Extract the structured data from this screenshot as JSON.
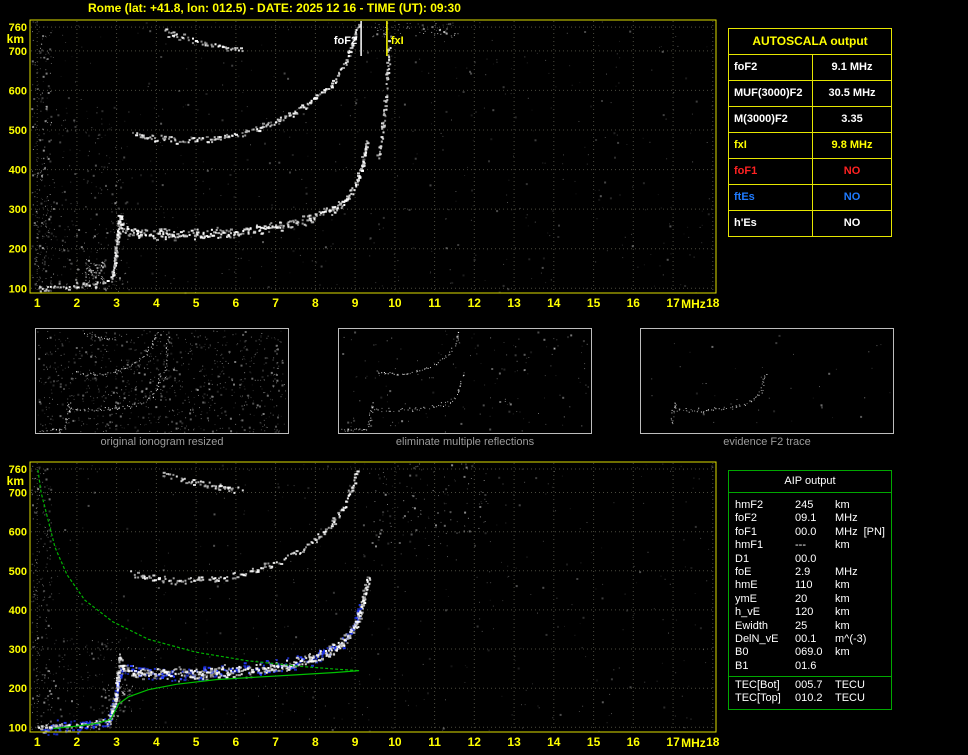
{
  "title": "Rome (lat: +41.8, lon: 012.5) - DATE: 2025 12 16 - TIME (UT): 09:30",
  "colors": {
    "accent_yellow": "#ffff00",
    "accent_green": "#00a800",
    "trace_white": "#ffffff",
    "trace_blue": "#2238ff",
    "profile_green": "#00c000",
    "alert_red": "#ff2222",
    "info_blue": "#1f7bff",
    "grid": "#4a4a3e"
  },
  "autoscala_table": {
    "header": "AUTOSCALA output",
    "rows": [
      {
        "label": "foF2",
        "value": "9.1 MHz",
        "color": "#ffffff"
      },
      {
        "label": "MUF(3000)F2",
        "value": "30.5 MHz",
        "color": "#ffffff"
      },
      {
        "label": "M(3000)F2",
        "value": "3.35",
        "color": "#ffffff"
      },
      {
        "label": "fxI",
        "value": "9.8 MHz",
        "color": "#ffff00"
      },
      {
        "label": "foF1",
        "value": "NO",
        "color": "#ff2222"
      },
      {
        "label": "ftEs",
        "value": "NO",
        "color": "#1f7bff"
      },
      {
        "label": "h'Es",
        "value": "NO",
        "color": "#ffffff"
      }
    ]
  },
  "aip_table": {
    "header": "AIP output",
    "rows": [
      {
        "label": "hmF2",
        "value": "245",
        "unit": "km",
        "note": ""
      },
      {
        "label": "foF2",
        "value": "09.1",
        "unit": "MHz",
        "note": ""
      },
      {
        "label": "foF1",
        "value": "00.0",
        "unit": "MHz",
        "note": "[PN]"
      },
      {
        "label": "hmF1",
        "value": "---",
        "unit": "km",
        "note": ""
      },
      {
        "label": "D1",
        "value": "00.0",
        "unit": "",
        "note": ""
      },
      {
        "label": "foE",
        "value": "2.9",
        "unit": "MHz",
        "note": ""
      },
      {
        "label": "hmE",
        "value": "110",
        "unit": "km",
        "note": ""
      },
      {
        "label": "ymE",
        "value": "20",
        "unit": "km",
        "note": ""
      },
      {
        "label": "h_vE",
        "value": "120",
        "unit": "km",
        "note": ""
      },
      {
        "label": "Ewidth",
        "value": "25",
        "unit": "km",
        "note": ""
      },
      {
        "label": "DelN_vE",
        "value": "00.1",
        "unit": "m^(-3)",
        "note": ""
      },
      {
        "label": "B0",
        "value": "069.0",
        "unit": "km",
        "note": ""
      },
      {
        "label": "B1",
        "value": "01.6",
        "unit": "",
        "note": ""
      }
    ],
    "tec_rows": [
      {
        "label": "TEC[Bot]",
        "value": "005.7",
        "unit": "TECU"
      },
      {
        "label": "TEC[Top]",
        "value": "010.2",
        "unit": "TECU"
      }
    ]
  },
  "thumbnails": [
    {
      "caption": "original ionogram resized",
      "series": [
        "E-trace",
        "cusp",
        "F-trace",
        "second-hop",
        "third-hop",
        "x-trace"
      ],
      "noise_count": 900
    },
    {
      "caption": "eliminate multiple reflections",
      "series": [
        "E-trace",
        "cusp",
        "F-trace",
        "second-hop"
      ],
      "noise_count": 160
    },
    {
      "caption": "evidence F2 trace",
      "series": [
        "cusp",
        "F-trace"
      ],
      "noise_count": 40
    }
  ],
  "chart_data": [
    {
      "id": "ionogram_autoscaled",
      "type": "scatter",
      "title": "",
      "xlabel": "MHz",
      "ylabel": "km",
      "xlim": [
        0.82,
        18.08
      ],
      "ylim": [
        88,
        778
      ],
      "xticks": [
        1,
        2,
        3,
        4,
        5,
        6,
        7,
        8,
        9,
        10,
        11,
        12,
        13,
        14,
        15,
        16,
        17,
        18
      ],
      "yticks": [
        760,
        700,
        600,
        500,
        400,
        300,
        200,
        100
      ],
      "grid": true,
      "legend": false,
      "markers": [
        {
          "label": "foF2",
          "x": 9.15,
          "color": "#ffffff"
        },
        {
          "label": "fxI",
          "x": 9.8,
          "color": "#ffff00"
        }
      ],
      "series": [
        {
          "name": "E-trace",
          "render": "scatter",
          "color": "#ffffff",
          "spread": 4,
          "density": 1,
          "points": [
            [
              1.05,
              98
            ],
            [
              1.5,
              102
            ],
            [
              2.0,
              105
            ],
            [
              2.5,
              108
            ],
            [
              2.85,
              118
            ]
          ]
        },
        {
          "name": "cusp",
          "render": "scatter",
          "color": "#ffffff",
          "spread": 5,
          "density": 2,
          "points": [
            [
              2.88,
              128
            ],
            [
              2.98,
              170
            ],
            [
              3.04,
              225
            ],
            [
              3.1,
              278
            ],
            [
              3.18,
              252
            ]
          ]
        },
        {
          "name": "F-trace",
          "render": "scatter",
          "color": "#ffffff",
          "spread": 6,
          "density": 2,
          "points": [
            [
              3.2,
              248
            ],
            [
              3.55,
              239
            ],
            [
              4.2,
              236
            ],
            [
              5.0,
              236
            ],
            [
              5.8,
              240
            ],
            [
              6.6,
              248
            ],
            [
              7.3,
              259
            ],
            [
              7.9,
              274
            ],
            [
              8.4,
              295
            ],
            [
              8.8,
              325
            ],
            [
              9.05,
              365
            ],
            [
              9.2,
              412
            ],
            [
              9.3,
              458
            ],
            [
              9.35,
              480
            ]
          ]
        },
        {
          "name": "second-hop",
          "render": "scatter",
          "color": "#ffffff",
          "spread": 4,
          "density": 1,
          "points": [
            [
              3.4,
              492
            ],
            [
              3.9,
              480
            ],
            [
              4.7,
              472
            ],
            [
              5.5,
              478
            ],
            [
              6.2,
              492
            ],
            [
              6.9,
              514
            ],
            [
              7.5,
              543
            ],
            [
              8.0,
              578
            ],
            [
              8.45,
              620
            ],
            [
              8.75,
              668
            ],
            [
              8.95,
              715
            ],
            [
              9.08,
              760
            ]
          ]
        },
        {
          "name": "third-hop",
          "render": "scatter",
          "color": "#ffffff",
          "spread": 4,
          "density": 1,
          "points": [
            [
              4.2,
              748
            ],
            [
              4.7,
              733
            ],
            [
              5.2,
              720
            ],
            [
              5.8,
              708
            ],
            [
              6.15,
              704
            ]
          ]
        },
        {
          "name": "x-trace",
          "render": "scatter",
          "color": "#e8e8e8",
          "spread": 3,
          "density": 1,
          "points": [
            [
              9.6,
              430
            ],
            [
              9.7,
              500
            ],
            [
              9.78,
              570
            ],
            [
              9.84,
              650
            ],
            [
              9.88,
              730
            ]
          ]
        }
      ],
      "noise": [
        {
          "f": [
            0.85,
            18.0
          ],
          "km": [
            90,
            775
          ],
          "count": 500,
          "bright": 0.35
        },
        {
          "f": [
            0.85,
            1.35
          ],
          "km": [
            90,
            775
          ],
          "count": 220,
          "bright": 0.6
        },
        {
          "f": [
            1.0,
            3.3
          ],
          "km": [
            95,
            320
          ],
          "count": 160,
          "bright": 0.5
        },
        {
          "f": [
            2.2,
            2.7
          ],
          "km": [
            110,
            175
          ],
          "count": 90,
          "bright": 0.8
        },
        {
          "f": [
            9.4,
            11.6
          ],
          "km": [
            735,
            772
          ],
          "count": 70,
          "bright": 0.7
        },
        {
          "f": [
            1.3,
            3.3
          ],
          "km": [
            330,
            560
          ],
          "count": 80,
          "bright": 0.4
        }
      ]
    },
    {
      "id": "ionogram_with_profile",
      "type": "scatter",
      "title": "",
      "xlabel": "MHz",
      "ylabel": "km",
      "xlim": [
        0.82,
        18.08
      ],
      "ylim": [
        88,
        778
      ],
      "xticks": [
        1,
        2,
        3,
        4,
        5,
        6,
        7,
        8,
        9,
        10,
        11,
        12,
        13,
        14,
        15,
        16,
        17,
        18
      ],
      "yticks": [
        760,
        700,
        600,
        500,
        400,
        300,
        200,
        100
      ],
      "grid": true,
      "legend": false,
      "markers": [],
      "series": [
        {
          "name": "fitted-trace",
          "render": "scatter",
          "color": "#2238ff",
          "spread": 8,
          "density": 2,
          "points": [
            [
              1.15,
              97
            ],
            [
              1.7,
              100
            ],
            [
              2.3,
              104
            ],
            [
              2.8,
              110
            ],
            [
              2.95,
              150
            ],
            [
              3.05,
              220
            ],
            [
              3.2,
              246
            ],
            [
              3.6,
              238
            ],
            [
              4.4,
              235
            ],
            [
              5.2,
              237
            ],
            [
              6.0,
              242
            ],
            [
              6.8,
              250
            ],
            [
              7.5,
              262
            ],
            [
              8.1,
              280
            ],
            [
              8.6,
              305
            ],
            [
              8.9,
              340
            ],
            [
              9.05,
              375
            ],
            [
              9.15,
              400
            ]
          ]
        },
        {
          "name": "E-trace",
          "render": "scatter",
          "color": "#ffffff",
          "spread": 4,
          "density": 1,
          "points": [
            [
              1.05,
              98
            ],
            [
              1.5,
              102
            ],
            [
              2.0,
              105
            ],
            [
              2.5,
              108
            ],
            [
              2.85,
              118
            ]
          ]
        },
        {
          "name": "cusp",
          "render": "scatter",
          "color": "#ffffff",
          "spread": 5,
          "density": 2,
          "points": [
            [
              2.88,
              128
            ],
            [
              2.98,
              170
            ],
            [
              3.04,
              225
            ],
            [
              3.1,
              278
            ],
            [
              3.18,
              252
            ]
          ]
        },
        {
          "name": "F-trace",
          "render": "scatter",
          "color": "#ffffff",
          "spread": 6,
          "density": 2,
          "points": [
            [
              3.2,
              248
            ],
            [
              3.55,
              239
            ],
            [
              4.2,
              236
            ],
            [
              5.0,
              236
            ],
            [
              5.8,
              240
            ],
            [
              6.6,
              248
            ],
            [
              7.3,
              259
            ],
            [
              7.9,
              274
            ],
            [
              8.4,
              295
            ],
            [
              8.8,
              325
            ],
            [
              9.05,
              365
            ],
            [
              9.2,
              412
            ],
            [
              9.3,
              458
            ],
            [
              9.35,
              480
            ]
          ]
        },
        {
          "name": "second-hop",
          "render": "scatter",
          "color": "#ffffff",
          "spread": 4,
          "density": 1,
          "points": [
            [
              3.4,
              492
            ],
            [
              3.9,
              480
            ],
            [
              4.7,
              472
            ],
            [
              5.5,
              478
            ],
            [
              6.2,
              492
            ],
            [
              6.9,
              514
            ],
            [
              7.5,
              543
            ],
            [
              8.0,
              578
            ],
            [
              8.45,
              620
            ],
            [
              8.75,
              668
            ],
            [
              8.95,
              715
            ],
            [
              9.08,
              760
            ]
          ]
        },
        {
          "name": "third-hop",
          "render": "scatter",
          "color": "#ffffff",
          "spread": 4,
          "density": 1,
          "points": [
            [
              4.2,
              748
            ],
            [
              4.7,
              733
            ],
            [
              5.2,
              720
            ],
            [
              5.8,
              708
            ],
            [
              6.15,
              704
            ]
          ]
        },
        {
          "name": "profile-topside",
          "render": "line",
          "color": "#00b400",
          "dash": "3,2",
          "points": [
            [
              1.02,
              758
            ],
            [
              1.1,
              700
            ],
            [
              1.25,
              640
            ],
            [
              1.45,
              560
            ],
            [
              1.75,
              490
            ],
            [
              2.2,
              425
            ],
            [
              2.9,
              370
            ],
            [
              3.8,
              325
            ],
            [
              5.0,
              292
            ],
            [
              6.3,
              270
            ],
            [
              7.6,
              256
            ],
            [
              8.6,
              248
            ],
            [
              9.1,
              245
            ]
          ]
        },
        {
          "name": "profile-bottomside",
          "render": "line",
          "color": "#00c000",
          "dash": "",
          "points": [
            [
              9.1,
              245
            ],
            [
              8.5,
              240
            ],
            [
              7.5,
              234
            ],
            [
              6.5,
              228
            ],
            [
              5.5,
              222
            ],
            [
              4.5,
              210
            ],
            [
              3.8,
              196
            ],
            [
              3.3,
              178
            ],
            [
              3.05,
              160
            ],
            [
              2.95,
              140
            ],
            [
              2.85,
              120
            ],
            [
              2.5,
              110
            ],
            [
              2.0,
              103
            ],
            [
              1.4,
              97
            ]
          ]
        }
      ],
      "noise": [
        {
          "f": [
            0.85,
            18.0
          ],
          "km": [
            90,
            775
          ],
          "count": 450,
          "bright": 0.35
        },
        {
          "f": [
            0.85,
            1.35
          ],
          "km": [
            90,
            775
          ],
          "count": 180,
          "bright": 0.55
        },
        {
          "f": [
            1.0,
            3.3
          ],
          "km": [
            95,
            330
          ],
          "count": 140,
          "bright": 0.5
        },
        {
          "f": [
            9.4,
            12.3
          ],
          "km": [
            560,
            775
          ],
          "count": 120,
          "bright": 0.6
        },
        {
          "f": [
            2.6,
            3.4
          ],
          "km": [
            140,
            210
          ],
          "count": 70,
          "bright": 0.7
        }
      ]
    }
  ]
}
